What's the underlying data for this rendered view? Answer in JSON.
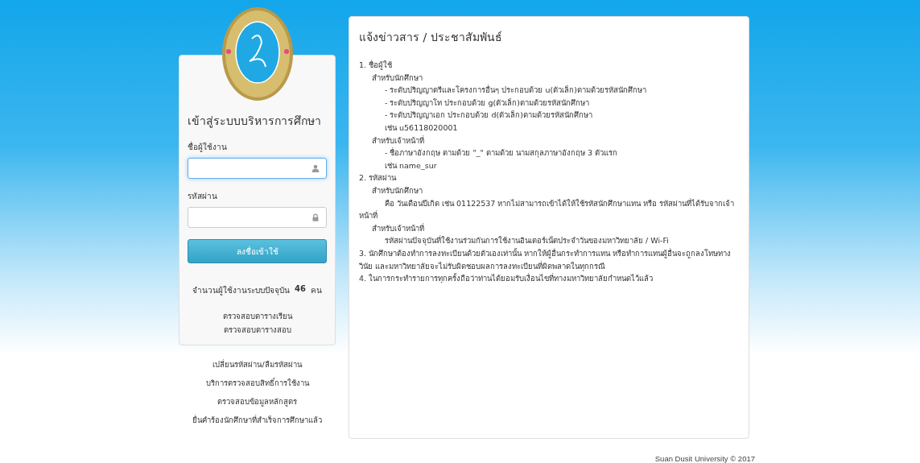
{
  "login": {
    "title": "เข้าสู่ระบบบริหารการศึกษา",
    "username": {
      "label": "ชื่อผู้ใช้งาน",
      "focused": true
    },
    "password": {
      "label": "รหัสผ่าน",
      "focused": false
    },
    "submit": "ลงชื่อเข้าใช้",
    "online": {
      "label": "จำนวนผู้ใช้งานระบบปัจจุบัน",
      "count": "46",
      "unit": "คน"
    },
    "links": [
      "ตรวจสอบตารางเรียน",
      "ตรวจสอบตารางสอบ"
    ]
  },
  "extra_links": [
    "เปลี่ยนรหัสผ่าน/ลืมรหัสผ่าน",
    "บริการตรวจสอบสิทธิ์การใช้งาน",
    "ตรวจสอบข้อมูลหลักสูตร",
    "ยื่นคำร้องนักศึกษาที่สำเร็จการศึกษาแล้ว"
  ],
  "news": {
    "title": "แจ้งข่าวสาร / ประชาสัมพันธ์",
    "items": [
      {
        "text": "1. ชื่อผู้ใช้",
        "children": [
          {
            "text": "สำหรับนักศึกษา",
            "children": [
              {
                "text": "- ระดับปริญญาตรีและโครงการอื่นๆ ประกอบด้วย u(ตัวเล็ก)ตามด้วยรหัสนักศึกษา"
              },
              {
                "text": "- ระดับปริญญาโท ประกอบด้วย g(ตัวเล็ก)ตามด้วยรหัสนักศึกษา"
              },
              {
                "text": "- ระดับปริญญาเอก ประกอบด้วย d(ตัวเล็ก)ตามด้วยรหัสนักศึกษา"
              },
              {
                "text": "เช่น u56118020001"
              }
            ]
          },
          {
            "text": "สำหรับเจ้าหน้าที่",
            "children": [
              {
                "text": "- ชื่อภาษาอังกฤษ ตามด้วย \"_\" ตามด้วย นามสกุลภาษาอังกฤษ 3 ตัวแรก"
              },
              {
                "text": "เช่น name_sur"
              }
            ]
          }
        ]
      },
      {
        "text": "2. รหัสผ่าน",
        "children": [
          {
            "text": "สำหรับนักศึกษา",
            "children": [
              {
                "text": "คือ วันเดือนปีเกิด เช่น 01122537 หากไม่สามารถเข้าได้ให้ใช้รหัสนักศึกษาแทน หรือ รหัสผ่านที่ได้รับจากเจ้าหน้าที่"
              }
            ]
          },
          {
            "text": "สำหรับเจ้าหน้าที่",
            "children": [
              {
                "text": "รหัสผ่านปัจจุบันที่ใช้งานร่วมกันการใช้งานอินเตอร์เน็ตประจำวันของมหาวิทยาลัย / Wi-Fi"
              }
            ]
          }
        ]
      },
      {
        "text": "3. นักศึกษาต้องทำการลงทะเบียนด้วยตัวเองเท่านั้น หากให้ผู้อื่นกระทำการแทน หรือทำการแทนผู้อื่นจะถูกลงโทษทางวินัย และมหาวิทยาลัยจะไม่รับผิดชอบผลการลงทะเบียนที่ผิดพลาดในทุกกรณี"
      },
      {
        "text": "4. ในการกระทำรายการทุกครั้งถือว่าท่านได้ยอมรับเงื่อนไขที่ทางมหาวิทยาลัยกำหนดไว้แล้ว"
      }
    ]
  },
  "footer": "Suan Dusit University © 2017"
}
